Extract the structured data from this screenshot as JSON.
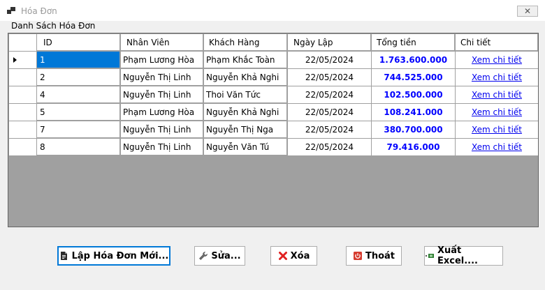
{
  "window": {
    "title": "Hóa Đơn",
    "close_glyph": "✕"
  },
  "group": {
    "label": "Danh Sách Hóa Đơn"
  },
  "grid": {
    "columns": [
      "ID",
      "Nhân Viên",
      "Khách Hàng",
      "Ngày Lập",
      "Tổng tiền",
      "Chi tiết"
    ],
    "rows": [
      [
        "1",
        "Phạm Lương Hòa",
        "Phạm Khắc Toàn",
        "22/05/2024",
        "1.763.600.000",
        "Xem chi tiết"
      ],
      [
        "2",
        "Nguyễn Thị Linh",
        "Nguyễn Khả Nghi",
        "22/05/2024",
        "744.525.000",
        "Xem chi tiết"
      ],
      [
        "4",
        "Nguyễn Thị Linh",
        "Thoi Văn Tức",
        "22/05/2024",
        "102.500.000",
        "Xem chi tiết"
      ],
      [
        "5",
        "Phạm Lương Hòa",
        "Nguyễn Khả Nghi",
        "22/05/2024",
        "108.241.000",
        "Xem chi tiết"
      ],
      [
        "7",
        "Nguyễn Thị Linh",
        "Nguyễn Thị Nga",
        "22/05/2024",
        "380.700.000",
        "Xem chi tiết"
      ],
      [
        "8",
        "Nguyễn Thị Linh",
        "Nguyễn Văn Tú",
        "22/05/2024",
        "79.416.000",
        "Xem chi tiết"
      ]
    ]
  },
  "buttons": {
    "create": "Lập Hóa Đơn Mới...",
    "edit": "Sửa...",
    "delete": "Xóa",
    "exit": "Thoát",
    "export": "Xuất Excel...."
  },
  "colors": {
    "selection": "#0078d7",
    "money": "#0000ff",
    "link": "#0000ee",
    "grid_background": "#a0a0a0"
  }
}
